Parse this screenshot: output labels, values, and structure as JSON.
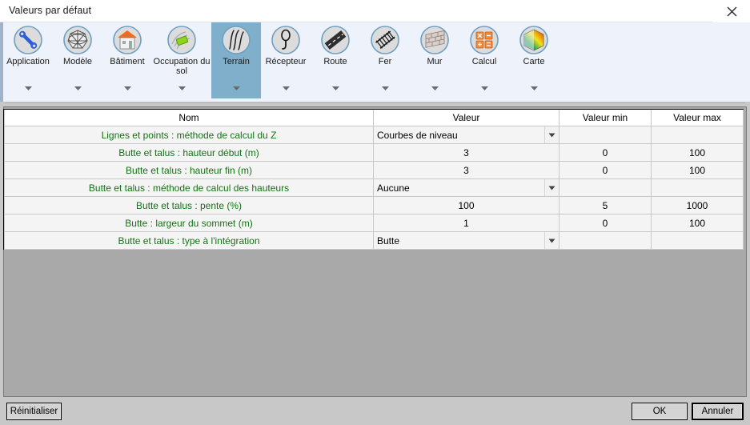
{
  "window": {
    "title": "Valeurs par défaut",
    "close_icon": "close-icon"
  },
  "ribbon": {
    "tabs": [
      {
        "label": "Application",
        "icon": "wrench-icon",
        "selected": false,
        "caret": true
      },
      {
        "label": "Modèle",
        "icon": "globe-mesh-icon",
        "selected": false,
        "caret": true
      },
      {
        "label": "Bâtiment",
        "icon": "building-icon",
        "selected": false,
        "caret": true
      },
      {
        "label": "Occupation du sol",
        "icon": "land-use-icon",
        "selected": false,
        "caret": true
      },
      {
        "label": "Terrain",
        "icon": "terrain-icon",
        "selected": true,
        "caret": true
      },
      {
        "label": "Récepteur",
        "icon": "receiver-icon",
        "selected": false,
        "caret": true
      },
      {
        "label": "Route",
        "icon": "road-icon",
        "selected": false,
        "caret": true
      },
      {
        "label": "Fer",
        "icon": "railway-icon",
        "selected": false,
        "caret": true
      },
      {
        "label": "Mur",
        "icon": "wall-icon",
        "selected": false,
        "caret": true
      },
      {
        "label": "Calcul",
        "icon": "calculator-icon",
        "selected": false,
        "caret": true
      },
      {
        "label": "Carte",
        "icon": "map-color-icon",
        "selected": false,
        "caret": true
      }
    ]
  },
  "grid": {
    "columns": [
      "Nom",
      "Valeur",
      "Valeur min",
      "Valeur max"
    ],
    "rows": [
      {
        "name": "Lignes et points : méthode de calcul du Z",
        "value": "Courbes de niveau",
        "type": "combo",
        "min": "",
        "max": ""
      },
      {
        "name": "Butte et talus : hauteur début (m)",
        "value": "3",
        "type": "text",
        "min": "0",
        "max": "100"
      },
      {
        "name": "Butte et talus : hauteur fin (m)",
        "value": "3",
        "type": "text",
        "min": "0",
        "max": "100"
      },
      {
        "name": "Butte et talus : méthode de calcul des hauteurs",
        "value": "Aucune",
        "type": "combo",
        "min": "",
        "max": ""
      },
      {
        "name": "Butte et talus : pente (%)",
        "value": "100",
        "type": "text",
        "min": "5",
        "max": "1000"
      },
      {
        "name": "Butte : largeur du sommet (m)",
        "value": "1",
        "type": "text",
        "min": "0",
        "max": "100"
      },
      {
        "name": "Butte et talus : type à l'intégration",
        "value": "Butte",
        "type": "combo",
        "min": "",
        "max": ""
      }
    ]
  },
  "footer": {
    "reset_label": "Réinitialiser",
    "ok_label": "OK",
    "cancel_label": "Annuler"
  },
  "colors": {
    "selected_tab": "#7fafcb",
    "ribbon_bg": "#eef2fb",
    "name_text": "#157215",
    "panel_bg": "#a9a9a9",
    "dialog_bg": "#c8c8c8"
  }
}
